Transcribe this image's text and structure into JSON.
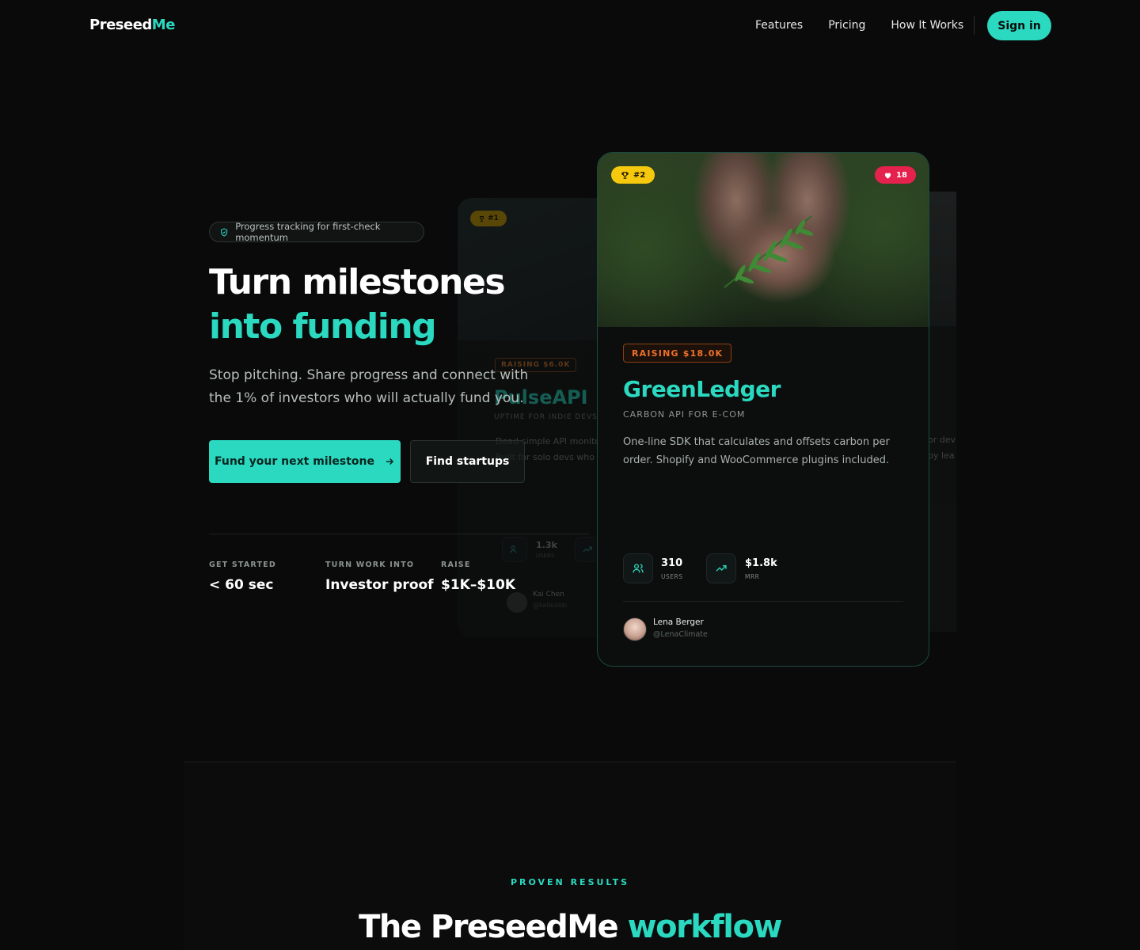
{
  "nav": {
    "logo_main": "Preseed",
    "logo_accent": "Me",
    "links": [
      "Features",
      "Pricing",
      "How It Works"
    ],
    "signin_label": "Sign in"
  },
  "hero": {
    "pill_text": "Progress tracking for first-check momentum",
    "title_line1": "Turn milestones",
    "title_line2": "into funding",
    "subtext": "Stop pitching. Share progress and connect with the 1% of investors who will actually fund you.",
    "primary_button": "Fund your next milestone",
    "secondary_button": "Find startups",
    "stats": [
      {
        "label": "GET STARTED",
        "value": "< 60 sec"
      },
      {
        "label": "TURN WORK INTO",
        "value": "Investor proof"
      },
      {
        "label": "RAISE",
        "value": "$1K–$10K"
      }
    ]
  },
  "bg_card_left": {
    "rank": "#1",
    "raising": "RAISING $6.0K",
    "name": "PulseAPI",
    "tagline": "UPTIME FOR INDIE DEVS",
    "desc_line1": "Dead-simple API monitor",
    "desc_line2": "Built for solo devs who ca",
    "users_value": "1.3k",
    "users_label": "USERS",
    "founder_name": "Kai Chen",
    "founder_handle": "@kaibuilds"
  },
  "bg_card_right": {
    "desc_line1": "or dev",
    "desc_line2": "by lea"
  },
  "card": {
    "rank": "#2",
    "likes": "18",
    "raising": "RAISING $18.0K",
    "name": "GreenLedger",
    "tagline": "CARBON API FOR E-COM",
    "description": "One-line SDK that calculates and offsets carbon per order. Shopify and WooCommerce plugins included.",
    "users_value": "310",
    "users_label": "USERS",
    "mrr_value": "$1.8k",
    "mrr_label": "MRR",
    "founder_name": "Lena Berger",
    "founder_handle": "@LenaClimate"
  },
  "section": {
    "eyebrow": "PROVEN RESULTS",
    "title_main": "The PreseedMe",
    "title_accent": "workflow"
  },
  "colors": {
    "accent": "#2bd9c0",
    "background": "#0a0a0a",
    "trophy_badge": "#f6c90e",
    "likes_badge": "#e5214d",
    "raising_orange": "#f0702a"
  },
  "icons": [
    "shield-check-icon",
    "arrow-right-icon",
    "trophy-icon",
    "heart-icon",
    "users-icon",
    "trending-up-icon"
  ]
}
